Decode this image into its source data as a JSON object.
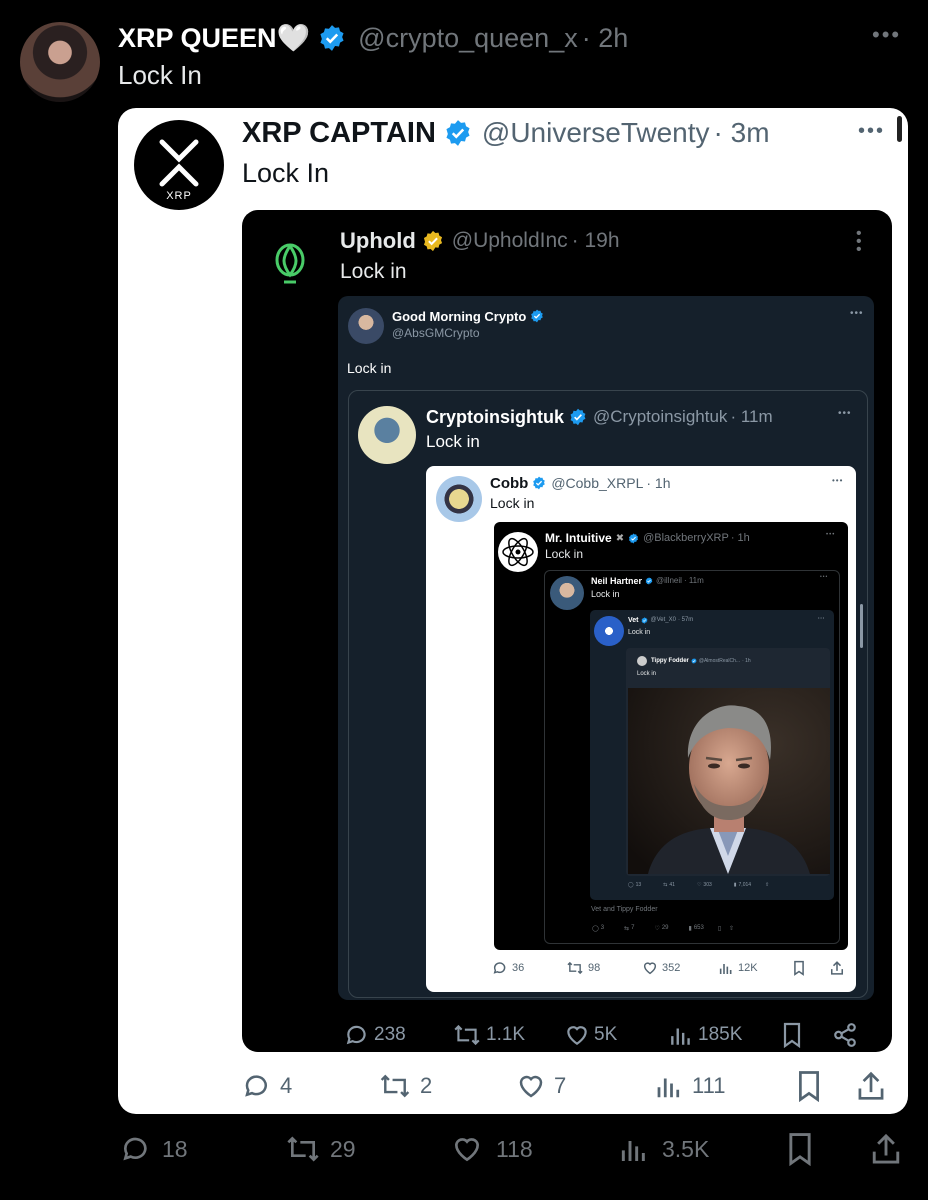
{
  "outer": {
    "name": "XRP QUEEN🤍",
    "handle": "@crypto_queen_x",
    "time": "· 2h",
    "text": "Lock In",
    "stats": {
      "replies": "18",
      "reposts": "29",
      "likes": "118",
      "views": "3.5K"
    }
  },
  "q1": {
    "name": "XRP CAPTAIN",
    "handle": "@UniverseTwenty",
    "time": "· 3m",
    "text": "Lock In",
    "avatar_label": "XRP",
    "stats": {
      "replies": "4",
      "reposts": "2",
      "likes": "7",
      "views": "111"
    }
  },
  "q2": {
    "name": "Uphold",
    "handle": "@UpholdInc",
    "time": "· 19h",
    "text": "Lock in",
    "stats": {
      "replies": "238",
      "reposts": "1.1K",
      "likes": "5K",
      "views": "185K"
    }
  },
  "q3": {
    "name": "Good Morning Crypto",
    "handle": "@AbsGMCrypto",
    "text": "Lock in"
  },
  "q4": {
    "name": "Cryptoinsightuk",
    "handle": "@Cryptoinsightuk",
    "time": "· 11m",
    "text": "Lock in"
  },
  "q5": {
    "name": "Cobb",
    "handle": "@Cobb_XRPL",
    "time": "· 1h",
    "text": "Lock in",
    "stats": {
      "replies": "36",
      "reposts": "98",
      "likes": "352",
      "views": "12K"
    }
  },
  "q6": {
    "name": "Mr. Intuitive",
    "handle": "@BlackberryXRP",
    "time": "· 1h",
    "text": "Lock in"
  },
  "q7": {
    "name": "Neil Hartner",
    "handle": "@illneil",
    "time": "· 11m",
    "text": "Lock in",
    "footer": "Vet and Tippy Fodder",
    "stats": {
      "replies": "3",
      "reposts": "7",
      "likes": "29",
      "views": "653"
    }
  },
  "q8": {
    "name": "Vet",
    "handle": "@Vet_X0",
    "time": "· 57m",
    "text": "Lock in",
    "stats": {
      "replies": "13",
      "reposts": "41",
      "likes": "303",
      "views": "7,014"
    }
  },
  "q9": {
    "name": "Tippy Fodder",
    "handle": "@AlmostRealCh...",
    "time": "· 1h",
    "text": "Lock in"
  },
  "colors": {
    "verified": "#1d9bf0",
    "gold": "#e8b820",
    "uphold": "#49cc68"
  }
}
